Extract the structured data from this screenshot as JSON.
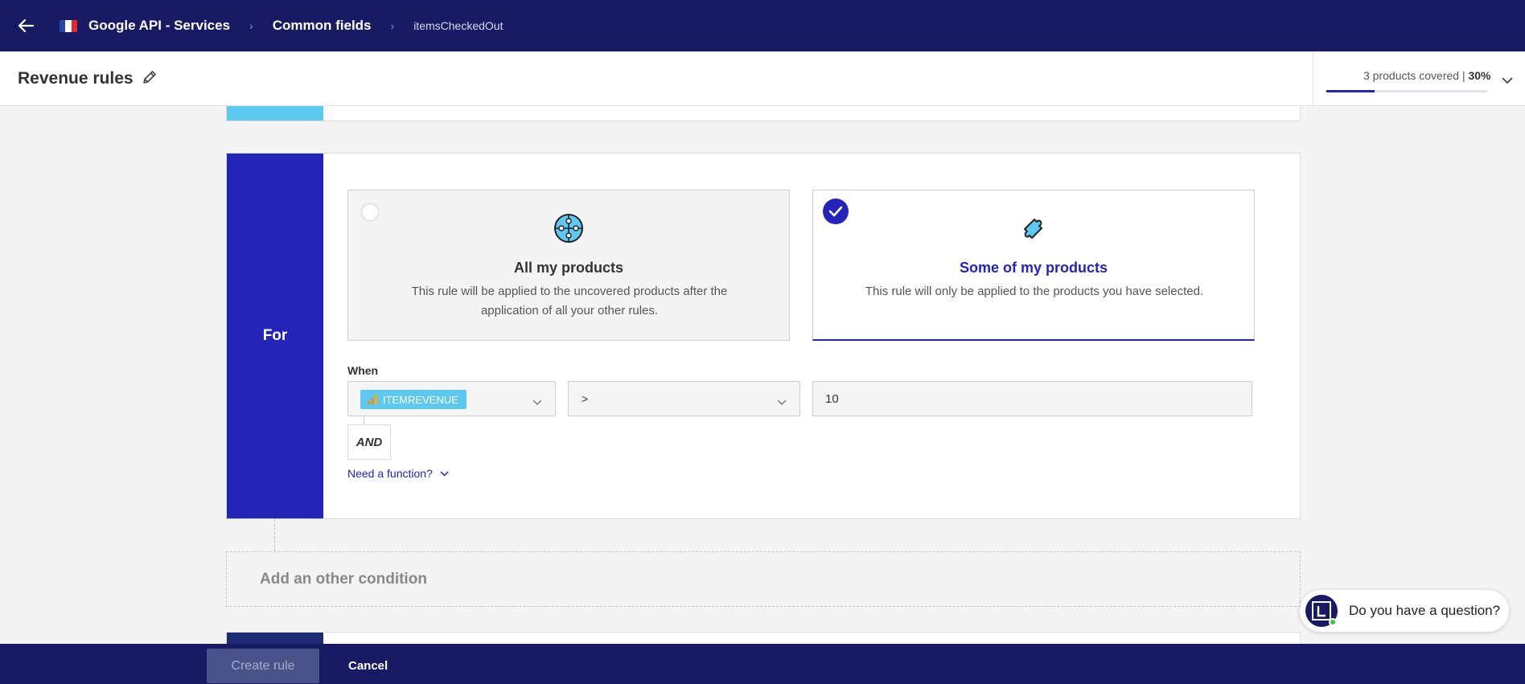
{
  "nav": {
    "back_icon": "arrow-left-icon",
    "flag_colors": [
      "#2447a6",
      "#ffffff",
      "#e0282e"
    ],
    "breadcrumbs": [
      "Google API - Services",
      "Common fields",
      "itemsCheckedOut"
    ]
  },
  "header": {
    "title": "Revenue rules",
    "edit_icon": "pencil-icon",
    "coverage": {
      "label": "3 products covered | ",
      "percent_label": "30%",
      "fraction": 0.3
    }
  },
  "for_card": {
    "side_label": "For",
    "options": [
      {
        "title": "All my products",
        "description": "This rule will be applied to the uncovered products after the application of all your other rules.",
        "selected": false,
        "icon": "puzzle-globe-icon"
      },
      {
        "title": "Some of my products",
        "description": "This rule will only be applied to the products you have selected.",
        "selected": true,
        "icon": "puzzle-piece-icon"
      }
    ],
    "when_label": "When",
    "field_chip": "ITEMREVENUE",
    "operator": ">",
    "value": "10",
    "and_label": "AND",
    "need_function": "Need a function?"
  },
  "add_condition": "Add an other condition",
  "chat": {
    "text": "Do you have a question?"
  },
  "footer": {
    "create_label": "Create rule",
    "cancel_label": "Cancel"
  },
  "colors": {
    "nav_bg": "#181a64",
    "accent": "#2424b8",
    "light_blue": "#5dc8f0",
    "online": "#3ec54f"
  }
}
